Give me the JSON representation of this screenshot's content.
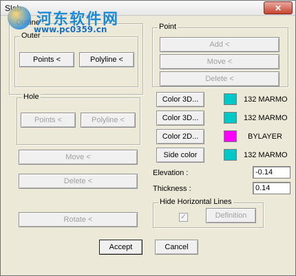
{
  "window": {
    "title": "Slab",
    "close_icon": "close-icon"
  },
  "outline": {
    "label": "Outline",
    "outer_label": "Outer",
    "points_label": "Points <",
    "polyline_label": "Polyline <"
  },
  "hole": {
    "label": "Hole",
    "points_label": "Points <",
    "polyline_label": "Polyline <"
  },
  "left_actions": {
    "move_label": "Move <",
    "delete_label": "Delete <",
    "rotate_label": "Rotate <"
  },
  "point": {
    "label": "Point",
    "add_label": "Add <",
    "move_label": "Move <",
    "delete_label": "Delete <"
  },
  "colors": {
    "rows": [
      {
        "button": "Color 3D...",
        "swatch": "#00c8c8",
        "value": "132 MARMO"
      },
      {
        "button": "Color 3D...",
        "swatch": "#00c8c8",
        "value": "132 MARMO"
      },
      {
        "button": "Color 2D...",
        "swatch": "#ff00ff",
        "value": "BYLAYER"
      },
      {
        "button": "Side color",
        "swatch": "#00c8c8",
        "value": "132 MARMO"
      }
    ]
  },
  "elevation": {
    "label": "Elevation :",
    "value": "-0.14"
  },
  "thickness": {
    "label": "Thickness :",
    "value": "0.14"
  },
  "hide_lines": {
    "label": "Hide Horizontal Lines",
    "checked": true,
    "definition_label": "Definition"
  },
  "footer": {
    "accept_label": "Accept",
    "cancel_label": "Cancel"
  },
  "watermark": {
    "text": "河东软件网",
    "url": "www.pc0359.cn"
  }
}
